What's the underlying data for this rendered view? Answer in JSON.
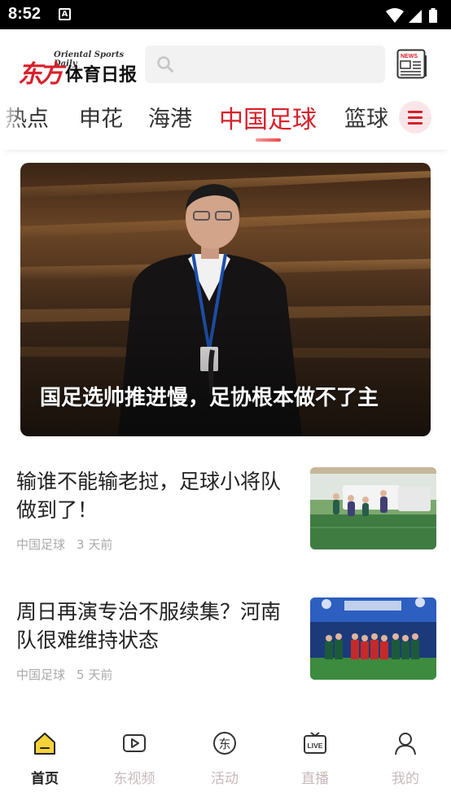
{
  "status_bar": {
    "time": "8:52",
    "notification_icon": "A"
  },
  "header": {
    "logo_en": "Oriental Sports Daily",
    "logo_red": "东方",
    "logo_black": "体育日报",
    "search_placeholder": "",
    "news_badge": "NEWS"
  },
  "tabs": [
    {
      "label": "热点"
    },
    {
      "label": "申花"
    },
    {
      "label": "海港"
    },
    {
      "label": "中国足球",
      "active": true
    },
    {
      "label": "篮球"
    }
  ],
  "hero": {
    "title": "国足选帅推进慢，足协根本做不了主"
  },
  "articles": [
    {
      "title": "输谁不能输老挝，足球小将队做到了！",
      "category": "中国足球",
      "time": "3 天前"
    },
    {
      "title": "周日再演专治不服续集？河南队很难维持状态",
      "category": "中国足球",
      "time": "5 天前"
    }
  ],
  "bottom_nav": [
    {
      "label": "首页",
      "icon": "home-icon",
      "active": true
    },
    {
      "label": "东视频",
      "icon": "video-icon"
    },
    {
      "label": "活动",
      "icon": "activity-icon"
    },
    {
      "label": "直播",
      "icon": "live-icon"
    },
    {
      "label": "我的",
      "icon": "profile-icon"
    }
  ],
  "colors": {
    "brand_red": "#d8202a",
    "active_nav": "#f6d23a",
    "inactive_text": "#c8b9ba"
  }
}
